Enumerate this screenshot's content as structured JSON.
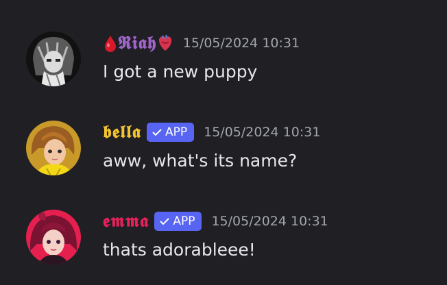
{
  "colors": {
    "background": "#1f1f24",
    "timestamp": "#a3a6ae",
    "message_text": "#e6e7ea",
    "app_badge": "#5865f2"
  },
  "messages": [
    {
      "username": "𝕽𝖎𝖆𝖍",
      "username_color": "#a065c8",
      "prefix_icon": "blood-drop-icon",
      "suffix_icon": "anatomical-heart-icon",
      "is_app": false,
      "timestamp": "15/05/2024 10:31",
      "content": "I got a new puppy",
      "avatar": "riah-avatar"
    },
    {
      "username": "𝖇𝖊𝖑𝖑𝖆",
      "username_color": "#f2c230",
      "is_app": true,
      "badge_label": "APP",
      "badge_icon": "checkmark-icon",
      "timestamp": "15/05/2024 10:31",
      "content": "aww, what's its name?",
      "avatar": "bella-avatar"
    },
    {
      "username": "𝖊𝖒𝖒𝖆",
      "username_color": "#e8215a",
      "is_app": true,
      "badge_label": "APP",
      "badge_icon": "checkmark-icon",
      "timestamp": "15/05/2024 10:31",
      "content": "thats adorableee!",
      "avatar": "emma-avatar"
    }
  ]
}
